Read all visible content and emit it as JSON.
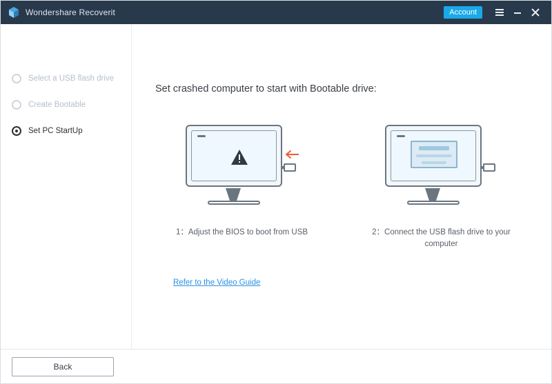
{
  "titlebar": {
    "app_name": "Wondershare Recoverit",
    "account_label": "Account"
  },
  "sidebar": {
    "steps": [
      {
        "label": "Select a USB flash drive",
        "active": false
      },
      {
        "label": "Create Bootable",
        "active": false
      },
      {
        "label": "Set PC StartUp",
        "active": true
      }
    ]
  },
  "main": {
    "heading": "Set crashed computer to start with Bootable drive:",
    "step1_caption": "1：Adjust the BIOS to boot from USB",
    "step2_caption": "2：Connect the USB flash drive to your computer",
    "video_link_label": "Refer to the Video Guide"
  },
  "footer": {
    "back_label": "Back"
  }
}
